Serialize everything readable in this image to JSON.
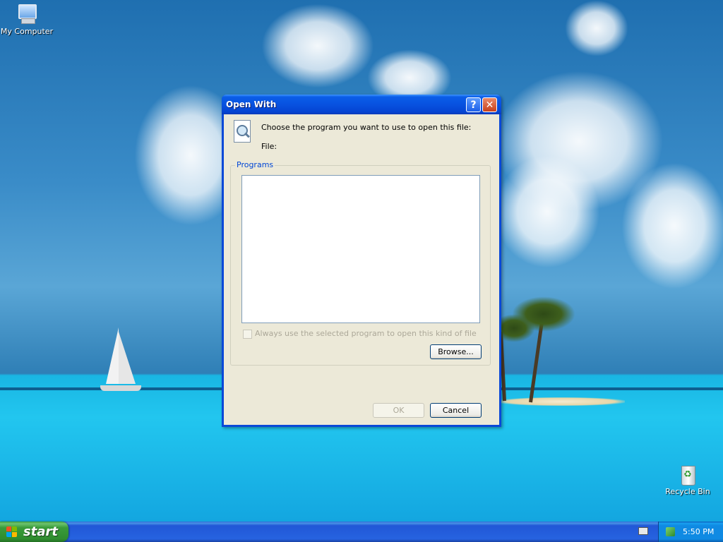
{
  "desktop": {
    "icons": [
      {
        "label": "My Computer",
        "icon": "computer-icon"
      },
      {
        "label": "Recycle Bin",
        "icon": "recycle-bin-icon"
      }
    ]
  },
  "dialog": {
    "title": "Open With",
    "help_glyph": "?",
    "close_glyph": "✕",
    "prompt": "Choose the program you want to use to open this file:",
    "file_label": "File:",
    "programs_label": "Programs",
    "programs": [],
    "always_use_label": "Always use the selected program to open this kind of file",
    "always_use_checked": false,
    "browse_label": "Browse...",
    "ok_label": "OK",
    "cancel_label": "Cancel"
  },
  "taskbar": {
    "start_label": "start",
    "clock": "5:50 PM"
  },
  "colors": {
    "title_bar": "#0852e0",
    "dialog_body": "#ece9d8",
    "start_button": "#3a9c3a",
    "taskbar": "#2663e0",
    "tray": "#0f8ae3"
  }
}
